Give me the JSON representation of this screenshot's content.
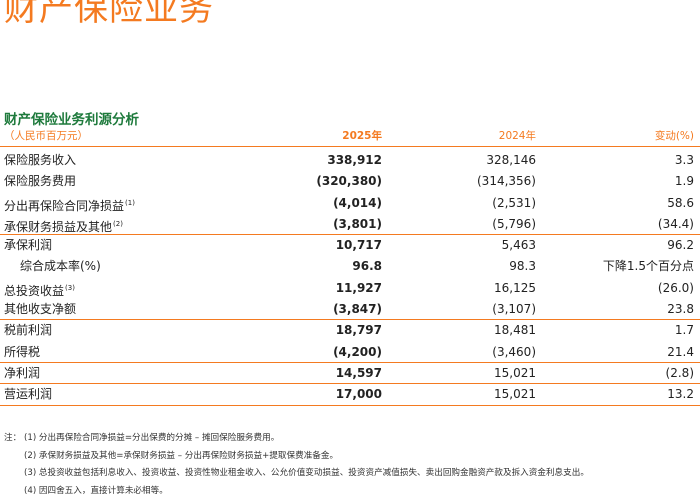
{
  "page_title": "财产保险业务",
  "section_title": "财产保险业务利源分析",
  "header": {
    "unit": "（人民币百万元）",
    "col_current": "2025年",
    "col_prev": "2024年",
    "col_change": "变动(%)"
  },
  "rows": [
    {
      "label": "保险服务收入",
      "note": "",
      "current": "338,912",
      "prev": "328,146",
      "change": "3.3"
    },
    {
      "label": "保险服务费用",
      "note": "",
      "current": "(320,380)",
      "prev": "(314,356)",
      "change": "1.9"
    },
    {
      "label": "分出再保险合同净损益",
      "note": "(1)",
      "current": "(4,014)",
      "prev": "(2,531)",
      "change": "58.6"
    },
    {
      "label": "承保财务损益及其他",
      "note": "(2)",
      "current": "(3,801)",
      "prev": "(5,796)",
      "change": "(34.4)"
    },
    {
      "label": "承保利润",
      "note": "",
      "current": "10,717",
      "prev": "5,463",
      "change": "96.2"
    },
    {
      "label": "综合成本率(%)",
      "note": "",
      "current": "96.8",
      "prev": "98.3",
      "change": "下降1.5个百分点"
    },
    {
      "label": "总投资收益",
      "note": "(3)",
      "current": "11,927",
      "prev": "16,125",
      "change": "(26.0)"
    },
    {
      "label": "其他收支净额",
      "note": "",
      "current": "(3,847)",
      "prev": "(3,107)",
      "change": "23.8"
    },
    {
      "label": "税前利润",
      "note": "",
      "current": "18,797",
      "prev": "18,481",
      "change": "1.7"
    },
    {
      "label": "所得税",
      "note": "",
      "current": "(4,200)",
      "prev": "(3,460)",
      "change": "21.4"
    },
    {
      "label": "净利润",
      "note": "",
      "current": "14,597",
      "prev": "15,021",
      "change": "(2.8)"
    },
    {
      "label": "营运利润",
      "note": "",
      "current": "17,000",
      "prev": "15,021",
      "change": "13.2"
    }
  ],
  "notes": {
    "prefix": "注：",
    "items": [
      "(1) 分出再保险合同净损益=分出保费的分摊 – 摊回保险服务费用。",
      "(2) 承保财务损益及其他=承保财务损益 – 分出再保险财务损益+提取保费准备金。",
      "(3) 总投资收益包括利息收入、投资收益、投资性物业租金收入、公允价值变动损益、投资资产减值损失、卖出回购金融资产款及拆入资金利息支出。",
      "(4) 因四舍五入，直接计算未必相等。"
    ]
  }
}
